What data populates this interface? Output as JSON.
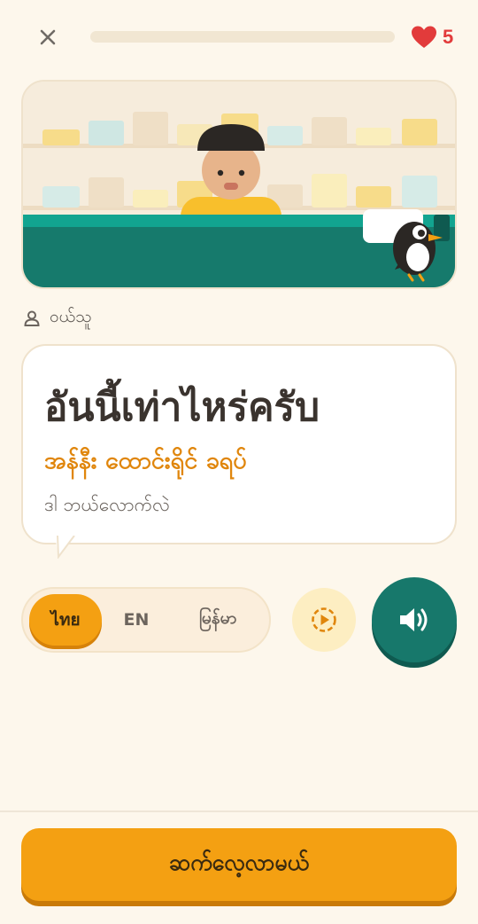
{
  "header": {
    "close_icon": "close-icon",
    "progress": 0,
    "lives": "5",
    "heart_icon": "heart-icon",
    "colors": {
      "heart": "#e23b3b",
      "progress_track": "#f1e6d2"
    }
  },
  "scene": {
    "illustration": "shopkeeper-behind-counter",
    "mascot_icon": "bird-mascot-icon"
  },
  "speaker": {
    "icon": "person-icon",
    "name": "ဝယ်သူ"
  },
  "bubble": {
    "thai": "อันนี้เท่าไหร่ครับ",
    "transliteration": "အန်နီး ထောင်းရိုင် ခရပ်",
    "meaning": "ဒါ ဘယ်လောက်လဲ"
  },
  "language_toggle": {
    "options": [
      {
        "label": "ไทย",
        "active": true
      },
      {
        "label": "EN",
        "active": false
      },
      {
        "label": "မြန်မာ",
        "active": false
      }
    ]
  },
  "controls": {
    "slow_icon": "slow-play-icon",
    "audio_icon": "speaker-icon"
  },
  "footer": {
    "continue_label": "ဆက်လေ့လာမယ်"
  },
  "colors": {
    "accent": "#f4a012",
    "teal": "#17786b",
    "background": "#fdf7ec",
    "translit": "#e0860c"
  }
}
